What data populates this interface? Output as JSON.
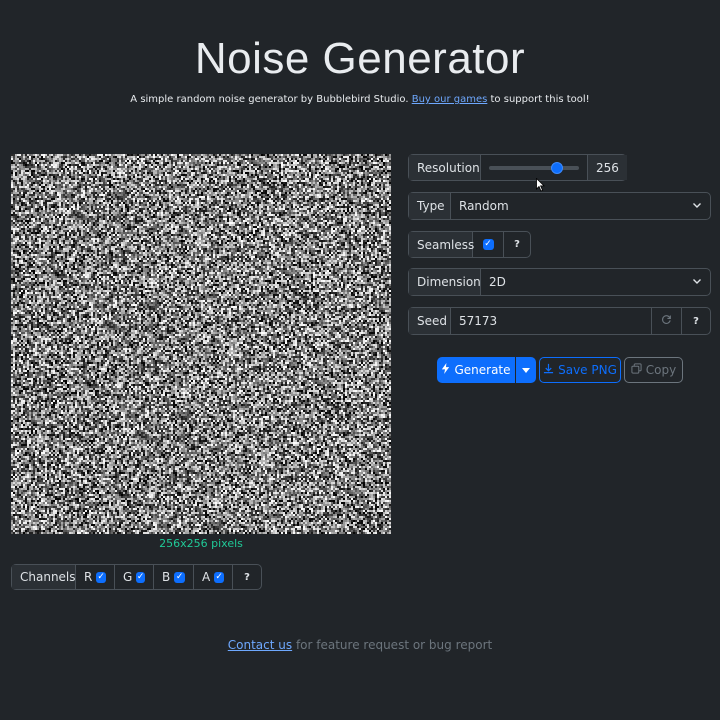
{
  "header": {
    "title": "Noise Generator",
    "subtitle_pre": "A simple random noise generator by Bubblebird Studio.",
    "subtitle_link": "Buy our games",
    "subtitle_post": "to support this tool!"
  },
  "preview": {
    "size_label": "256x256 pixels"
  },
  "channels": {
    "label": "Channels",
    "items": [
      {
        "label": "R",
        "checked": true
      },
      {
        "label": "G",
        "checked": true
      },
      {
        "label": "B",
        "checked": true
      },
      {
        "label": "A",
        "checked": true
      }
    ],
    "help": "?"
  },
  "settings": {
    "resolution": {
      "label": "Resolution",
      "value": "256",
      "slider_fraction": 0.76
    },
    "type": {
      "label": "Type",
      "value": "Random"
    },
    "seamless": {
      "label": "Seamless",
      "checked": true,
      "help": "?"
    },
    "dimension": {
      "label": "Dimension",
      "value": "2D"
    },
    "seed": {
      "label": "Seed",
      "value": "57173",
      "help": "?"
    }
  },
  "actions": {
    "generate": "Generate",
    "save_png": "Save PNG",
    "copy": "Copy"
  },
  "footer": {
    "link": "Contact us",
    "text": "for feature request or bug report"
  },
  "colors": {
    "background": "#212529",
    "primary": "#0d6efd",
    "link": "#6ea8fe",
    "size_label": "#20c997"
  },
  "icons": [
    "check-icon",
    "chevron-down-icon",
    "refresh-icon",
    "bolt-icon",
    "download-icon",
    "copy-icon",
    "caret-down-icon",
    "mouse-cursor-icon"
  ]
}
